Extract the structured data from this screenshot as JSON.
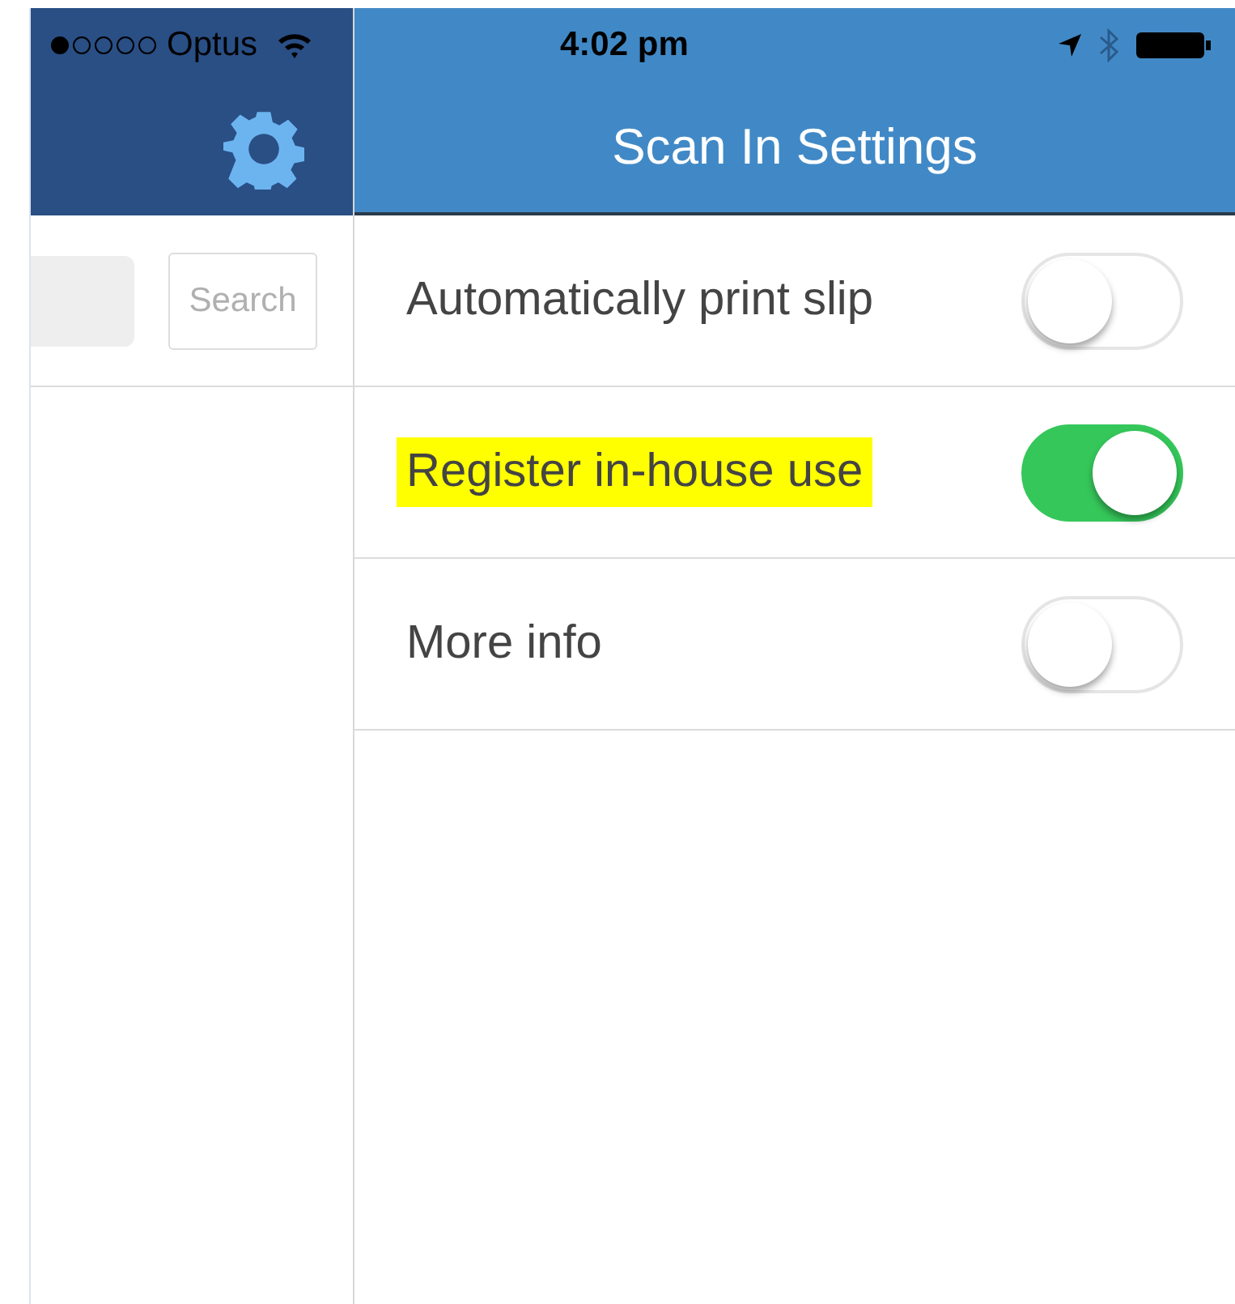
{
  "status_bar": {
    "carrier": "Optus",
    "time": "4:02 pm"
  },
  "sidebar": {
    "search_button": "Search"
  },
  "header": {
    "title": "Scan In Settings"
  },
  "settings": [
    {
      "label": "Automatically print slip",
      "on": false,
      "highlighted": false
    },
    {
      "label": "Register in-house use",
      "on": true,
      "highlighted": true
    },
    {
      "label": "More info",
      "on": false,
      "highlighted": false
    }
  ]
}
